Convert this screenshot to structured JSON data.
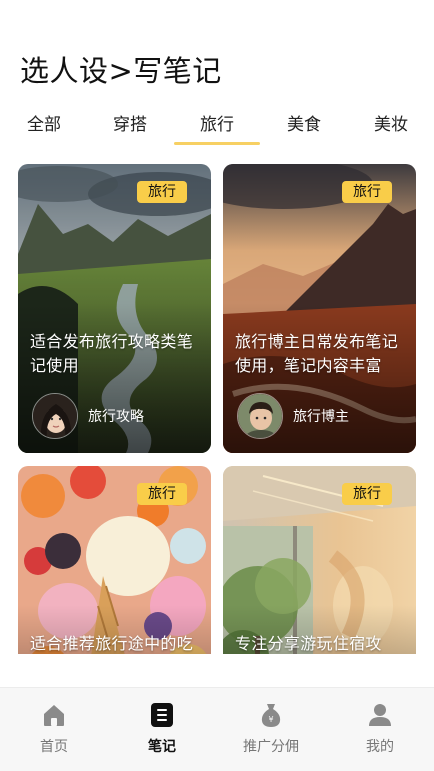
{
  "page": {
    "title": "选人设>写笔记"
  },
  "tabs": [
    {
      "label": "全部"
    },
    {
      "label": "穿搭"
    },
    {
      "label": "旅行",
      "active": true
    },
    {
      "label": "美食"
    },
    {
      "label": "美妆"
    }
  ],
  "cards": [
    {
      "badge": "旅行",
      "text": "适合发布旅行攻略类笔记使用",
      "author": "旅行攻略"
    },
    {
      "badge": "旅行",
      "text": "旅行博主日常发布笔记使用，笔记内容丰富",
      "author": "旅行博主"
    },
    {
      "badge": "旅行",
      "text": "适合推荐旅行途中的吃"
    },
    {
      "badge": "旅行",
      "text": "专注分享游玩住宿攻"
    }
  ],
  "nav": [
    {
      "label": "首页",
      "icon": "home-icon"
    },
    {
      "label": "笔记",
      "icon": "note-icon",
      "active": true
    },
    {
      "label": "推广分佣",
      "icon": "money-bag-icon"
    },
    {
      "label": "我的",
      "icon": "user-icon"
    }
  ],
  "colors": {
    "accent": "#f7d063",
    "badge": "#f9cd49",
    "nav_bg": "#f7f7f7"
  }
}
